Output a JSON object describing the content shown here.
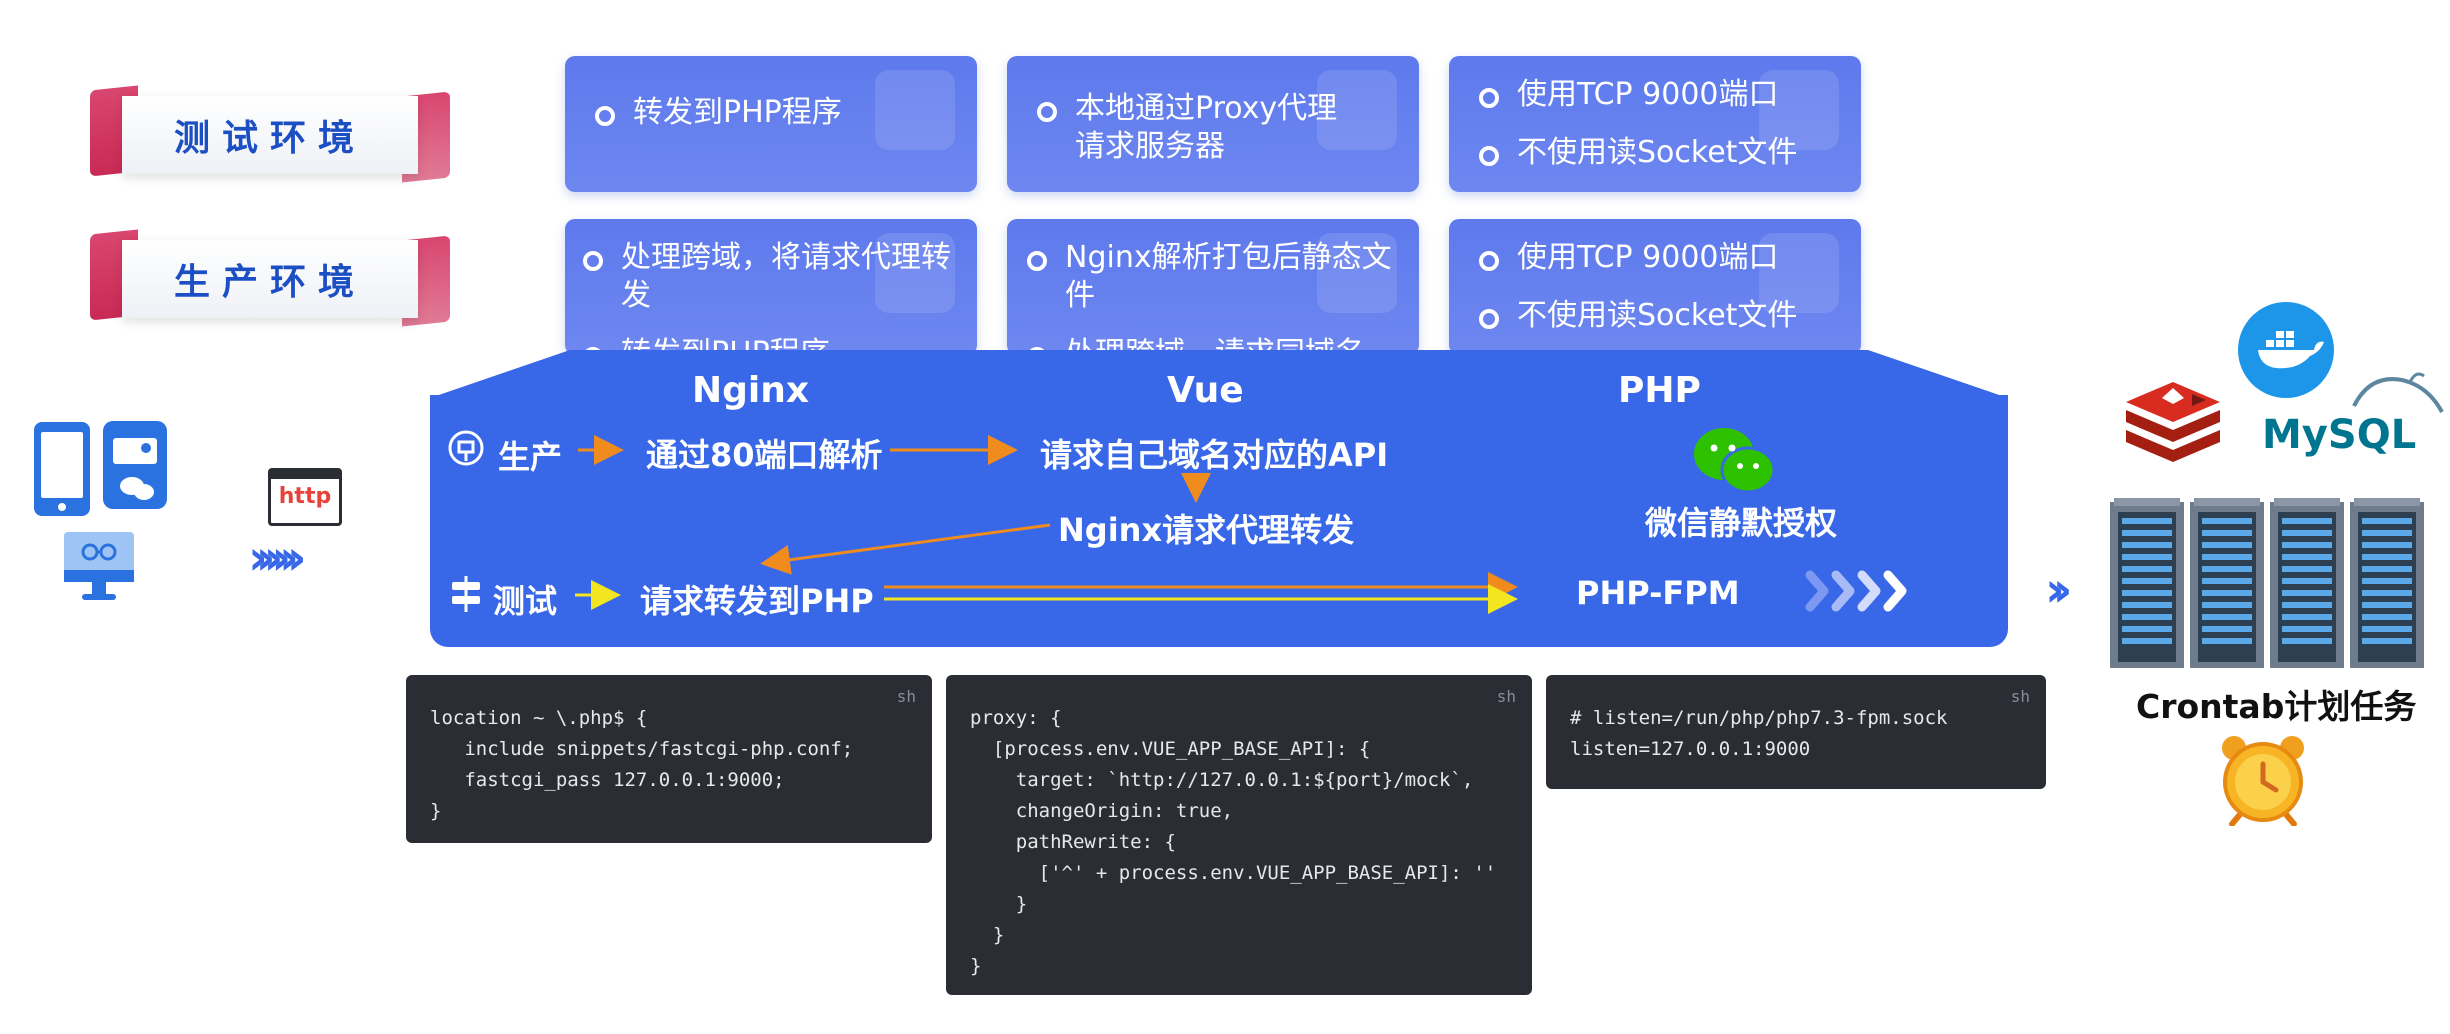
{
  "environments": {
    "test": "测试环境",
    "production": "生产环境"
  },
  "cards": {
    "test": [
      {
        "items": [
          "转发到PHP程序"
        ]
      },
      {
        "items": [
          "本地通过Proxy代理\n请求服务器"
        ]
      },
      {
        "items": [
          "使用TCP 9000端口",
          "不使用读Socket文件"
        ]
      }
    ],
    "production": [
      {
        "items": [
          "处理跨域，将请求代理转发",
          "转发到PHP程序"
        ]
      },
      {
        "items": [
          "Nginx解析打包后静态文件",
          "处理跨域，请求同域名"
        ]
      },
      {
        "items": [
          "使用TCP 9000端口",
          "不使用读Socket文件"
        ]
      }
    ]
  },
  "panel": {
    "headers": {
      "nginx": "Nginx",
      "vue": "Vue",
      "php": "PHP"
    },
    "prod_label": "生产",
    "test_label": "测试",
    "prod_step1": "通过80端口解析",
    "prod_step2": "请求自己域名对应的API",
    "proxy_step": "Nginx请求代理转发",
    "test_step1": "请求转发到PHP",
    "wechat": "微信静默授权",
    "php_fpm": "PHP-FPM"
  },
  "left_icons": {
    "http": "http"
  },
  "code": {
    "lang": "sh",
    "nginx": "location ~ \\.php$ {\n   include snippets/fastcgi-php.conf;\n   fastcgi_pass 127.0.0.1:9000;\n}",
    "vue": "proxy: {\n  [process.env.VUE_APP_BASE_API]: {\n    target: `http://127.0.0.1:${port}/mock`,\n    changeOrigin: true,\n    pathRewrite: {\n      ['^' + process.env.VUE_APP_BASE_API]: ''\n    }\n  }\n}",
    "php": "# listen=/run/php/php7.3-fpm.sock\nlisten=127.0.0.1:9000"
  },
  "right": {
    "mysql": "MySQL",
    "crontab": "Crontab计划任务"
  },
  "colors": {
    "panel": "#3868e8",
    "card": "#6680ee",
    "ribbon": "#d13a63",
    "orange_arrow": "#f08c1e",
    "yellow_arrow": "#f3e51f",
    "code_bg": "#2b2d35"
  },
  "icons": [
    "phone-icon",
    "id-card-icon",
    "wechat-icon",
    "monitor-icon",
    "http-icon",
    "docker-icon",
    "redis-icon",
    "mysql-icon",
    "server-rack-icon",
    "alarm-clock-icon"
  ]
}
